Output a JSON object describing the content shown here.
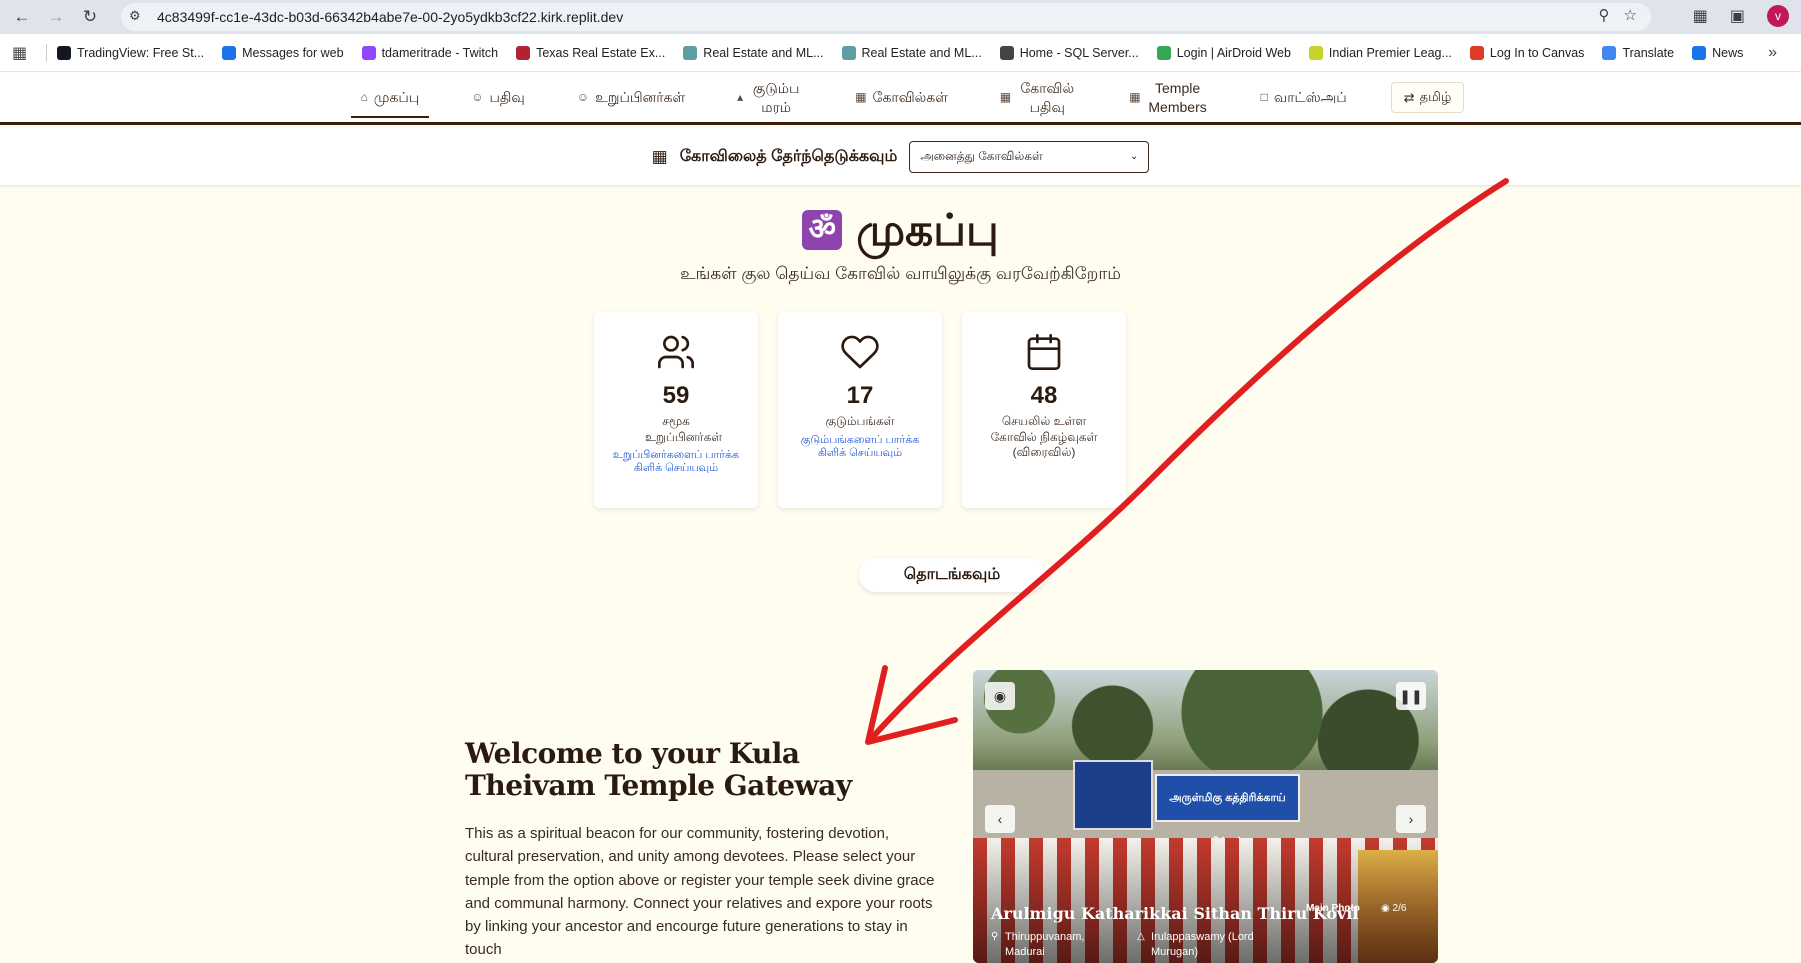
{
  "browser": {
    "url": "4c83499f-cc1e-43dc-b03d-66342b4abe7e-00-2yo5ydkb3cf22.kirk.replit.dev",
    "profile_initial": "v",
    "bookmarks": [
      {
        "label": "TradingView: Free St...",
        "color": "#131722"
      },
      {
        "label": "Messages for web",
        "color": "#1a73e8"
      },
      {
        "label": "tdameritrade - Twitch",
        "color": "#9146ff"
      },
      {
        "label": "Texas Real Estate Ex...",
        "color": "#b22234"
      },
      {
        "label": "Real Estate and ML...",
        "color": "#5f9ea0"
      },
      {
        "label": "Real Estate and ML...",
        "color": "#5f9ea0"
      },
      {
        "label": "Home - SQL Server...",
        "color": "#444444"
      },
      {
        "label": "Login | AirDroid Web",
        "color": "#34a853"
      },
      {
        "label": "Indian Premier Leag...",
        "color": "#c6d32a"
      },
      {
        "label": "Log In to Canvas",
        "color": "#e03b24"
      },
      {
        "label": "Translate",
        "color": "#4285f4"
      },
      {
        "label": "News",
        "color": "#1a73e8"
      }
    ]
  },
  "nav": {
    "items": [
      {
        "label": "முகப்பு",
        "icon": "home-icon"
      },
      {
        "label": "பதிவு",
        "icon": "user-plus-icon"
      },
      {
        "label": "உறுப்பினர்கள்",
        "icon": "users-icon"
      },
      {
        "label": "குடும்ப மரம்",
        "icon": "tree-icon"
      },
      {
        "label": "கோவில்கள்",
        "icon": "building-icon"
      },
      {
        "label": "கோவில் பதிவு",
        "icon": "building-icon"
      },
      {
        "label": "Temple Members",
        "icon": "building-icon"
      },
      {
        "label": "வாட்ஸ்அப்",
        "icon": "message-icon"
      }
    ],
    "language": "தமிழ்"
  },
  "temple_select": {
    "label": "கோவிலைத் தேர்ந்தெடுக்கவும்",
    "value": "அனைத்து கோவில்கள்"
  },
  "hero": {
    "om": "ॐ",
    "title": "முகப்பு",
    "subtitle": "உங்கள் குல தெய்வ கோவில் வாயிலுக்கு வரவேற்கிறோம்"
  },
  "stats": [
    {
      "icon": "users-icon",
      "number": "59",
      "label": "சமூக உறுப்பினர்கள்",
      "link": "உறுப்பினர்களைப் பார்க்க கிளிக் செய்யவும்"
    },
    {
      "icon": "heart-icon",
      "number": "17",
      "label": "குடும்பங்கள்",
      "link": "குடும்பங்களைப் பார்க்க கிளிக் செய்யவும்"
    },
    {
      "icon": "calendar-icon",
      "number": "48",
      "label": "செயலில் உள்ள கோவில் நிகழ்வுகள் (விரைவில்)",
      "link": ""
    }
  ],
  "start_button": "தொடங்கவும்",
  "welcome": {
    "title": "Welcome to your Kula Theivam Temple Gateway",
    "text": "This as a spiritual beacon for our community, fostering devotion, cultural preservation, and unity among devotees. Please select your temple from the option above or register your temple seek divine grace and communal harmony. Connect your relatives and expore your roots by linking your ancestor and encourge future generations to stay in touch"
  },
  "carousel": {
    "sign_text": "அருள்மிகு கத்திரிக்காய் சித்தன்",
    "temple_name": "Arulmigu Katharikkai Sithan Thiru Kovil",
    "tag": "Main Photo",
    "count": "2/6",
    "location": "Thiruppuvanam, Madurai",
    "deity": "Irulappaswamy (Lord Murugan)"
  },
  "colors": {
    "page_bg": "#fffdf0",
    "brown": "#3a1f0f",
    "link": "#1a56db",
    "annotation": "#e02020"
  }
}
